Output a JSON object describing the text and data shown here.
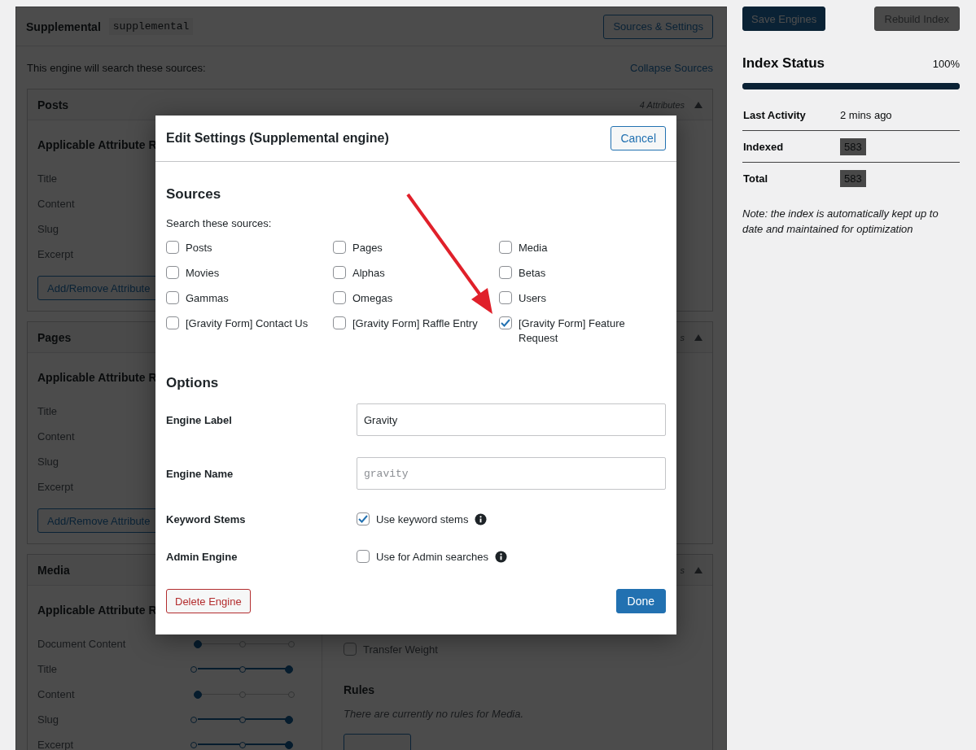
{
  "engine": {
    "title": "Supplemental",
    "slug": "supplemental",
    "settings_button": "Sources & Settings",
    "intro": "This engine will search these sources:",
    "collapse_link": "Collapse Sources",
    "sources": [
      {
        "kind": "list",
        "name": "Posts",
        "count": "4 Attributes",
        "heading": "Applicable Attribute R",
        "attributes": [
          "Title",
          "Content",
          "Slug",
          "Excerpt"
        ],
        "button": "Add/Remove Attribute"
      },
      {
        "kind": "list",
        "name": "Pages",
        "count": "s",
        "heading": "Applicable Attribute R",
        "attributes": [
          "Title",
          "Content",
          "Slug",
          "Excerpt"
        ],
        "button": "Add/Remove Attribute"
      },
      {
        "kind": "weights",
        "name": "Media",
        "count": "s",
        "heading": "Applicable Attribute R",
        "weights": [
          {
            "label": "Document Content",
            "level": 0
          },
          {
            "label": "Title",
            "level": 1
          },
          {
            "label": "Content",
            "level": 0
          },
          {
            "label": "Slug",
            "level": 1
          },
          {
            "label": "Excerpt",
            "level": 1
          }
        ],
        "transfer_weight": {
          "label": "Transfer Weight",
          "checked": false
        },
        "rules_title": "Rules",
        "rules_note": "There are currently no rules for Media."
      }
    ]
  },
  "sidebar": {
    "save_button": "Save Engines",
    "rebuild_button": {
      "label": "Rebuild Index",
      "disabled": true
    },
    "status_title": "Index Status",
    "percent": "100%",
    "level": 1,
    "stats": [
      {
        "kind": "plain",
        "label": "Last Activity",
        "value": "2 mins ago"
      },
      {
        "kind": "chip",
        "label": "Indexed",
        "value": "583"
      },
      {
        "kind": "chip",
        "label": "Total",
        "value": "583"
      }
    ],
    "note": "Note: the index is automatically kept up to date and maintained for optimization"
  },
  "modal": {
    "title": "Edit Settings (Supplemental engine)",
    "cancel_button": "Cancel",
    "sources_title": "Sources",
    "sources_prompt": "Search these sources:",
    "sources": [
      {
        "label": "Posts",
        "checked": false
      },
      {
        "label": "Pages",
        "checked": false
      },
      {
        "label": "Media",
        "checked": false
      },
      {
        "label": "Movies",
        "checked": false
      },
      {
        "label": "Alphas",
        "checked": false
      },
      {
        "label": "Betas",
        "checked": false
      },
      {
        "label": "Gammas",
        "checked": false
      },
      {
        "label": "Omegas",
        "checked": false
      },
      {
        "label": "Users",
        "checked": false
      },
      {
        "label": "[Gravity Form] Contact Us",
        "checked": false
      },
      {
        "label": "[Gravity Form] Raffle Entry",
        "checked": false
      },
      {
        "label": "[Gravity Form] Feature Request",
        "checked": true
      }
    ],
    "options_title": "Options",
    "options": [
      {
        "kind": "text",
        "label": "Engine Label",
        "value": "Gravity"
      },
      {
        "kind": "code",
        "label": "Engine Name",
        "placeholder": "gravity"
      },
      {
        "kind": "checkbox",
        "label": "Keyword Stems",
        "text": "Use keyword stems",
        "checked": true,
        "info": true
      },
      {
        "kind": "checkbox",
        "label": "Admin Engine",
        "text": "Use for Admin searches",
        "checked": false,
        "info": true
      }
    ],
    "delete_button": "Delete Engine",
    "done_button": "Done"
  }
}
